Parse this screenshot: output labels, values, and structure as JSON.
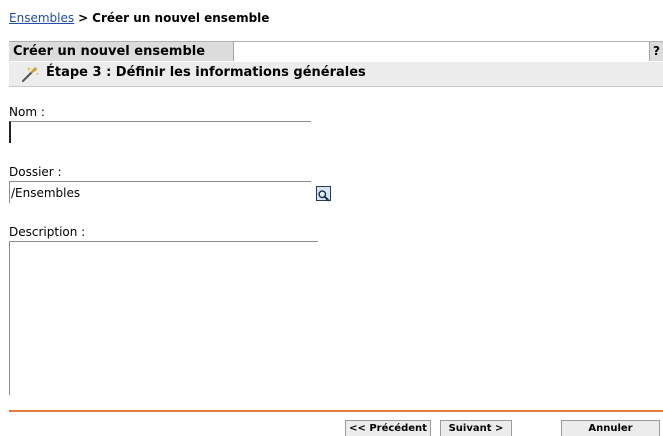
{
  "breadcrumb": {
    "link": "Ensembles",
    "separator": ">",
    "current": "Créer un nouvel ensemble"
  },
  "wizard": {
    "tab_title": "Créer un nouvel ensemble",
    "help_label": "?",
    "step_title": "Étape 3 : Définir les informations générales",
    "step_icon": "wand-icon"
  },
  "form": {
    "name_label": "Nom :",
    "name_value": "",
    "folder_label": "Dossier :",
    "folder_value": "/Ensembles",
    "browse_icon": "magnifier-icon",
    "description_label": "Description :",
    "description_value": ""
  },
  "footer": {
    "previous_label": "<< Précédent",
    "next_label": "Suivant >",
    "cancel_label": "Annuler"
  },
  "colors": {
    "link": "#1f4ea6",
    "divider": "#e07a3c",
    "tab_bg": "#dcdcdc",
    "step_bg": "#ececec"
  }
}
